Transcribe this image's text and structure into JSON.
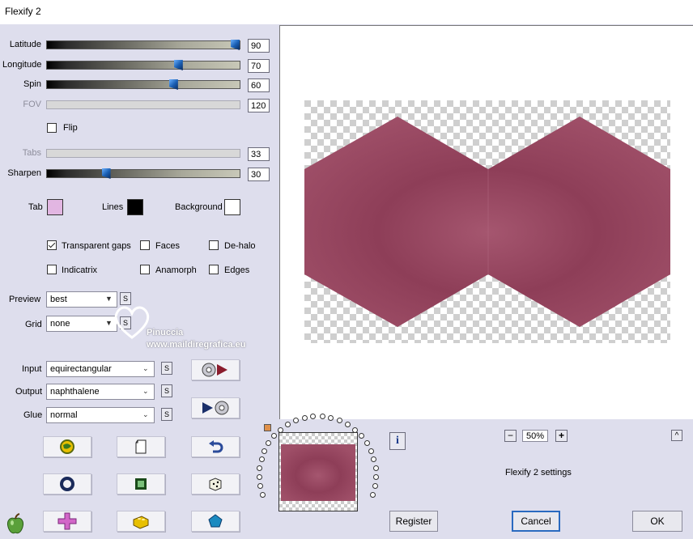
{
  "window": {
    "title": "Flexify 2"
  },
  "sliders": [
    {
      "label": "Latitude",
      "value": "90",
      "level": 0.975,
      "enabled": true
    },
    {
      "label": "Longitude",
      "value": "70",
      "level": 0.68,
      "enabled": true
    },
    {
      "label": "Spin",
      "value": "60",
      "level": 0.655,
      "enabled": true
    },
    {
      "label": "FOV",
      "value": "120",
      "level": null,
      "enabled": false
    },
    {
      "label": "Tabs",
      "value": "33",
      "level": null,
      "enabled": false
    },
    {
      "label": "Sharpen",
      "value": "30",
      "level": 0.305,
      "enabled": true
    }
  ],
  "flip": {
    "label": "Flip",
    "checked": false
  },
  "colors": {
    "tab": {
      "label": "Tab",
      "hex": "#e2b6e2"
    },
    "lines": {
      "label": "Lines",
      "hex": "#000000"
    },
    "background": {
      "label": "Background",
      "hex": "#ffffff"
    }
  },
  "options": [
    {
      "label": "Transparent gaps",
      "checked": true
    },
    {
      "label": "Faces",
      "checked": false
    },
    {
      "label": "De-halo",
      "checked": false
    },
    {
      "label": "Indicatrix",
      "checked": false
    },
    {
      "label": "Anamorph",
      "checked": false
    },
    {
      "label": "Edges",
      "checked": false
    }
  ],
  "preview_select": {
    "label": "Preview",
    "value": "best"
  },
  "grid_select": {
    "label": "Grid",
    "value": "none"
  },
  "input_select": {
    "label": "Input",
    "value": "equirectangular"
  },
  "output_select": {
    "label": "Output",
    "value": "naphthalene"
  },
  "glue_select": {
    "label": "Glue",
    "value": "normal"
  },
  "small_button_label": "S",
  "watermark": {
    "line1": "Pinuccia",
    "line2": "www.maildiregrafica.eu"
  },
  "zoom": {
    "minus": "−",
    "value": "50%",
    "plus": "+"
  },
  "settings_label": "Flexify 2 settings",
  "buttons": {
    "info": "i",
    "register": "Register",
    "cancel": "Cancel",
    "ok": "OK",
    "up": "^"
  },
  "accent_color": "#9a4462",
  "icons": [
    "globe-icon",
    "page-icon",
    "undo-icon",
    "ring-icon",
    "square-icon",
    "dice-icon",
    "cross-icon",
    "brick-icon",
    "pentagon-icon",
    "disc-play-icon",
    "play-disc-icon",
    "apple-icon"
  ]
}
